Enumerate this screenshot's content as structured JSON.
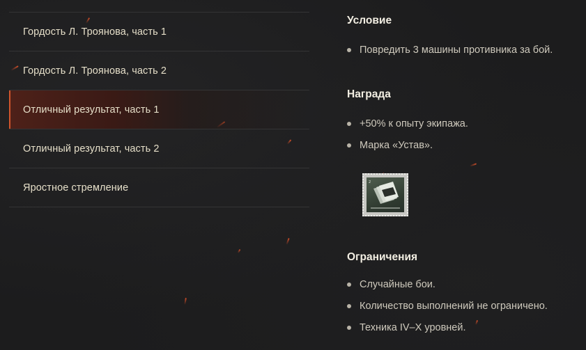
{
  "missions": [
    {
      "label": "Гордость Л. Троянова, часть 1",
      "active": false
    },
    {
      "label": "Гордость Л. Троянова, часть 2",
      "active": false
    },
    {
      "label": "Отличный результат, часть 1",
      "active": true
    },
    {
      "label": "Отличный результат, часть 2",
      "active": false
    },
    {
      "label": "Яростное стремление",
      "active": false
    }
  ],
  "details": {
    "condition": {
      "title": "Условие",
      "items": [
        "Повредить 3 машины противника за бой."
      ]
    },
    "reward": {
      "title": "Награда",
      "items": [
        "+50% к опыту экипажа.",
        "Марка «Устав»."
      ],
      "stamp_icon": "regulations-stamp-icon"
    },
    "restrictions": {
      "title": "Ограничения",
      "items": [
        "Случайные бои.",
        "Количество выполнений не ограничено.",
        "Техника IV–X уровней."
      ]
    }
  },
  "colors": {
    "accent": "#d0542c",
    "active_bg": "#4e2119",
    "background": "#1c1c1d"
  }
}
